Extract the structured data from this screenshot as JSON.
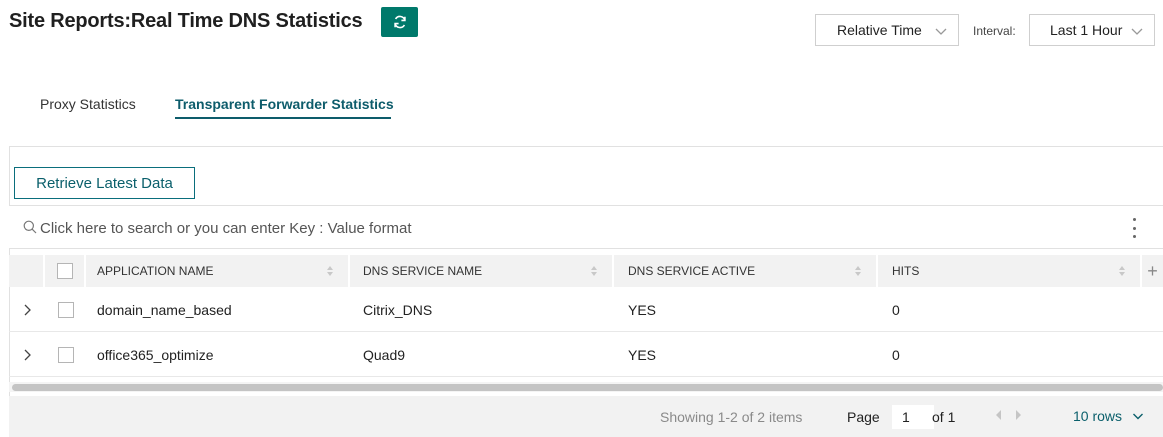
{
  "header": {
    "title": "Site Reports:Real Time DNS Statistics",
    "time_mode": "Relative Time",
    "interval_label": "Interval:",
    "interval_value": "Last 1 Hour"
  },
  "tabs": [
    {
      "label": "Proxy Statistics",
      "active": false
    },
    {
      "label": "Transparent Forwarder Statistics",
      "active": true
    }
  ],
  "toolbar": {
    "retrieve_label": "Retrieve Latest Data"
  },
  "search": {
    "placeholder": "Click here to search or you can enter Key : Value format"
  },
  "table": {
    "columns": [
      "APPLICATION NAME",
      "DNS SERVICE NAME",
      "DNS SERVICE ACTIVE",
      "HITS"
    ],
    "rows": [
      {
        "app": "domain_name_based",
        "dns": "Citrix_DNS",
        "active": "YES",
        "hits": "0"
      },
      {
        "app": "office365_optimize",
        "dns": "Quad9",
        "active": "YES",
        "hits": "0"
      }
    ]
  },
  "pagination": {
    "showing": "Showing 1-2 of 2 items",
    "page_label": "Page",
    "page_value": "1",
    "of_label": "of 1",
    "rows_label": "10 rows"
  },
  "colors": {
    "accent": "#00796b",
    "tab_active": "#0d5c6b",
    "header_bg": "#f2f2f2"
  }
}
